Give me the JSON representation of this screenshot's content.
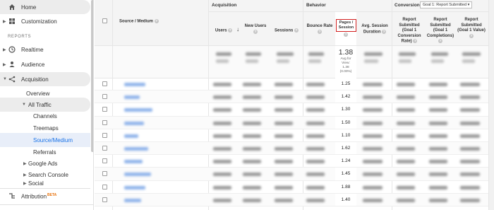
{
  "sidebar": {
    "items": [
      {
        "label": "Home",
        "icon": "home-icon"
      },
      {
        "label": "Customization",
        "icon": "customization-icon"
      },
      {
        "label": "Realtime",
        "icon": "clock-icon"
      },
      {
        "label": "Audience",
        "icon": "person-icon"
      },
      {
        "label": "Acquisition",
        "icon": "acquisition-icon"
      },
      {
        "label": "Overview"
      },
      {
        "label": "All Traffic"
      },
      {
        "label": "Channels"
      },
      {
        "label": "Treemaps"
      },
      {
        "label": "Source/Medium"
      },
      {
        "label": "Referrals"
      },
      {
        "label": "Google Ads"
      },
      {
        "label": "Search Console"
      },
      {
        "label": "Social"
      },
      {
        "label": "Attribution",
        "badge": "BETA",
        "icon": "attribution-icon"
      }
    ],
    "section_label": "REPORTS"
  },
  "table": {
    "groups": {
      "acquisition": "Acquisition",
      "behavior": "Behavior",
      "conversions": "Conversions"
    },
    "goal_select": "Goal 1: Report Submitted",
    "columns": {
      "source_medium": "Source / Medium",
      "users": "Users",
      "new_users": "New Users",
      "sessions": "Sessions",
      "bounce_rate": "Bounce Rate",
      "pages_session": "Pages / Session",
      "avg_session": "Avg. Session Duration",
      "conv_rate": "Report Submitted (Goal 1 Conversion Rate)",
      "completions": "Report Submitted (Goal 1 Completions)",
      "value": "Report Submitted (Goal 1 Value)"
    },
    "totals": {
      "pages_session": "1.38",
      "pages_sub_1": "Avg for",
      "pages_sub_2": "View:",
      "pages_sub_3": "1.38",
      "pages_sub_4": "(0.00%)"
    },
    "rows": [
      {
        "pages_session": "1.25"
      },
      {
        "pages_session": "1.42"
      },
      {
        "pages_session": "1.30"
      },
      {
        "pages_session": "1.50"
      },
      {
        "pages_session": "1.10"
      },
      {
        "pages_session": "1.62"
      },
      {
        "pages_session": "1.24"
      },
      {
        "pages_session": "1.45"
      },
      {
        "pages_session": "1.88"
      },
      {
        "pages_session": "1.40"
      }
    ]
  },
  "colors": {
    "accent": "#1a73e8",
    "highlight_border": "#d21f1f",
    "beta": "#e8710a"
  }
}
